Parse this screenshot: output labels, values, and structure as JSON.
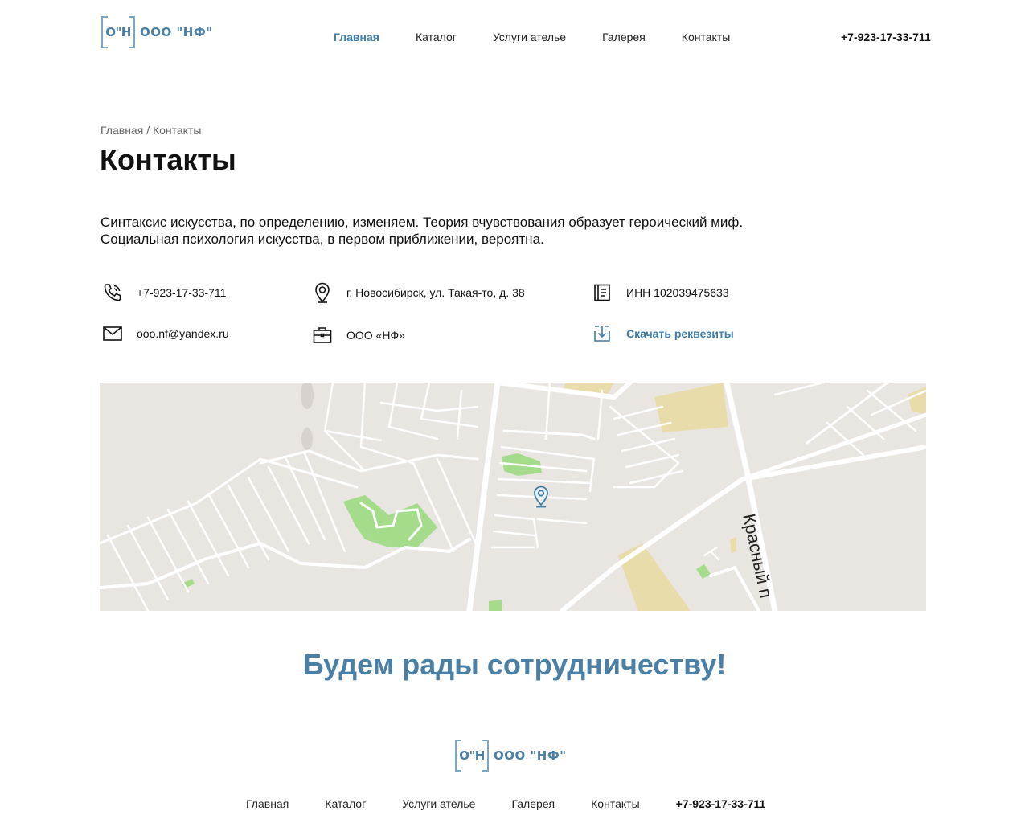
{
  "brand": {
    "mark": "О\"Н",
    "name": "ООО \"НФ\""
  },
  "nav": [
    {
      "label": "Главная",
      "active": true
    },
    {
      "label": "Каталог",
      "active": false
    },
    {
      "label": "Услуги ателье",
      "active": false
    },
    {
      "label": "Галерея",
      "active": false
    },
    {
      "label": "Контакты",
      "active": false
    }
  ],
  "header_phone": "+7-923-17-33-711",
  "breadcrumb": {
    "home": "Главная",
    "separator": "/",
    "current": "Контакты"
  },
  "page_title": "Контакты",
  "intro": "Синтаксис искусства, по определению, изменяем. Теория вчувствования образует героический миф. Социальная психология искусства, в первом приближении, вероятна.",
  "contacts": {
    "phone": "+7-923-17-33-711",
    "address": "г. Новосибирск, ул. Такая-то, д. 38",
    "inn": "ИНН 102039475633",
    "email": "ooo.nf@yandex.ru",
    "company": "ООО «НФ»",
    "download": "Скачать реквезиты"
  },
  "map": {
    "street_label": "Красный п"
  },
  "slogan": "Будем рады сотрудничеству!",
  "footer": {
    "nav": [
      "Главная",
      "Каталог",
      "Услуги ателье",
      "Галерея",
      "Контакты"
    ],
    "phone": "+7-923-17-33-711"
  },
  "colors": {
    "accent": "#3f7ca8",
    "logo": "#4a7fa6",
    "map_bg": "#e9e6e1",
    "park": "#a5dc8c",
    "sand": "#e8dcaa"
  },
  "icons": [
    "phone-icon",
    "location-pin-icon",
    "document-icon",
    "mail-icon",
    "briefcase-icon",
    "download-icon",
    "map-pin-icon"
  ]
}
